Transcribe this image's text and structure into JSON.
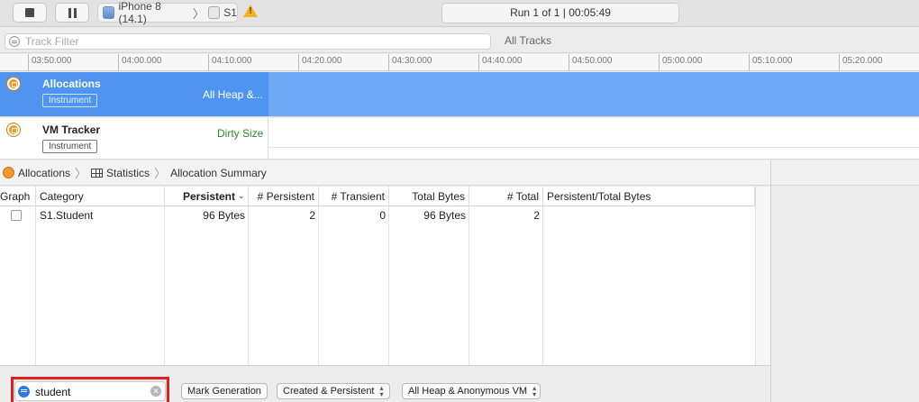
{
  "toolbar": {
    "device": "iPhone 8 (14.1)",
    "target": "S1",
    "run_status": "Run 1 of 1  |  00:05:49"
  },
  "filter": {
    "placeholder": "Track Filter",
    "all_tracks": "All Tracks"
  },
  "ruler": {
    "ticks": [
      "03:50.000",
      "04:00.000",
      "04:10.000",
      "04:20.000",
      "04:30.000",
      "04:40.000",
      "04:50.000",
      "05:00.000",
      "05:10.000",
      "05:20.000"
    ]
  },
  "tracks": [
    {
      "name": "Allocations",
      "badge": "Instrument",
      "detail": "All Heap &...",
      "selected": true
    },
    {
      "name": "VM Tracker",
      "badge": "Instrument",
      "detail": "Dirty Size",
      "selected": false
    }
  ],
  "breadcrumb": {
    "items": [
      "Allocations",
      "Statistics",
      "Allocation Summary"
    ]
  },
  "table": {
    "columns": [
      "Graph",
      "Category",
      "Persistent",
      "# Persistent",
      "# Transient",
      "Total Bytes",
      "# Total",
      "Persistent/Total Bytes"
    ],
    "rows": [
      {
        "category": "S1.Student",
        "persistent": "96 Bytes",
        "num_persistent": "2",
        "num_transient": "0",
        "total_bytes": "96 Bytes",
        "num_total": "2",
        "ratio": ""
      }
    ]
  },
  "bottom": {
    "search_value": "student",
    "mark_generation": "Mark Generation",
    "lifespan": "Created & Persistent",
    "allocation_type": "All Heap & Anonymous VM"
  },
  "colors": {
    "selected_track": "#4f94f1",
    "highlight": "#e0201d",
    "dirty_size": "#2a8a2a"
  }
}
